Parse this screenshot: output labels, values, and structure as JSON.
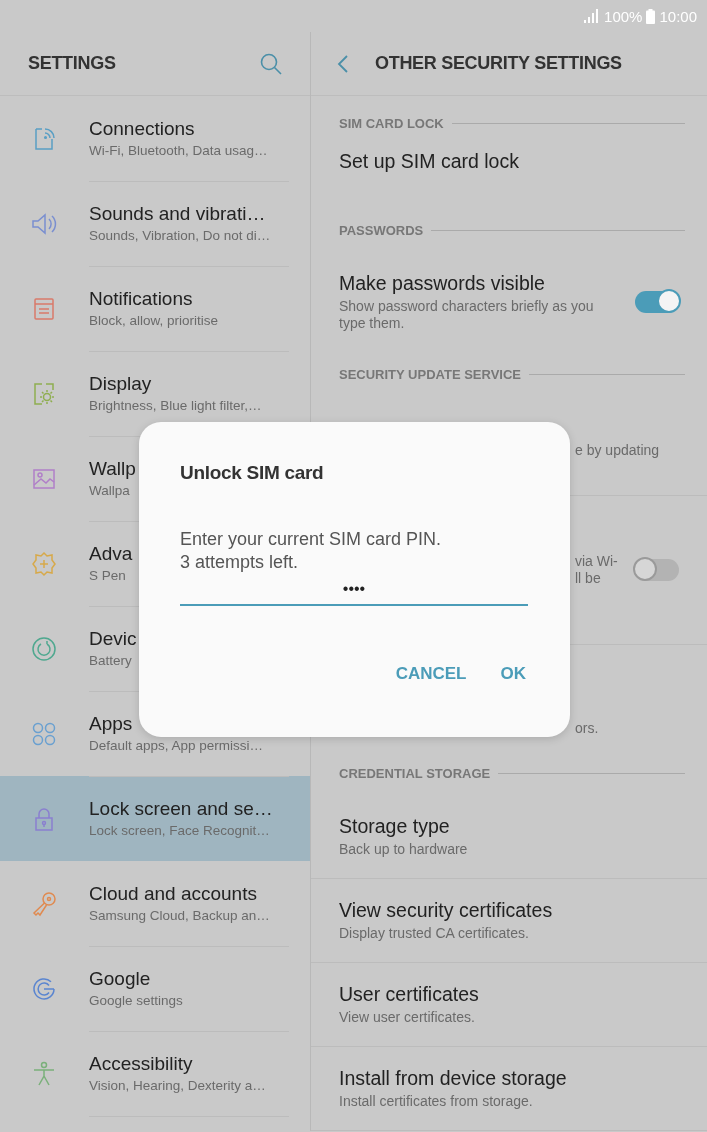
{
  "status_bar": {
    "battery": "100%",
    "time": "10:00"
  },
  "left": {
    "title": "SETTINGS",
    "items": [
      {
        "title": "Connections",
        "subtitle": "Wi-Fi, Bluetooth, Data usag…",
        "selected": false
      },
      {
        "title": "Sounds and vibrati…",
        "subtitle": "Sounds, Vibration, Do not di…",
        "selected": false
      },
      {
        "title": "Notifications",
        "subtitle": "Block, allow, prioritise",
        "selected": false
      },
      {
        "title": "Display",
        "subtitle": "Brightness, Blue light filter,…",
        "selected": false
      },
      {
        "title": "Wallp",
        "subtitle": "Wallpa",
        "selected": false
      },
      {
        "title": "Adva",
        "subtitle": "S Pen",
        "selected": false
      },
      {
        "title": "Devic",
        "subtitle": "Battery",
        "selected": false
      },
      {
        "title": "Apps",
        "subtitle": "Default apps, App permissi…",
        "selected": false
      },
      {
        "title": "Lock screen and se…",
        "subtitle": "Lock screen, Face Recognit…",
        "selected": true
      },
      {
        "title": "Cloud and accounts",
        "subtitle": "Samsung Cloud, Backup an…",
        "selected": false
      },
      {
        "title": "Google",
        "subtitle": "Google settings",
        "selected": false
      },
      {
        "title": "Accessibility",
        "subtitle": "Vision, Hearing, Dexterity a…",
        "selected": false
      }
    ]
  },
  "right": {
    "title": "OTHER SECURITY SETTINGS",
    "rows": [
      {
        "kind": "header",
        "text": "SIM CARD LOCK"
      },
      {
        "kind": "item",
        "title": "Set up SIM card lock"
      },
      {
        "kind": "header",
        "text": "PASSWORDS"
      },
      {
        "kind": "item",
        "title": "Make passwords visible",
        "subtitle": "Show password characters briefly as you type them.",
        "on": true
      },
      {
        "kind": "header",
        "text": "SECURITY UPDATE SERVICE"
      },
      {
        "kind": "partial",
        "lines": [
          "e by updating"
        ]
      },
      {
        "kind": "partial",
        "lines": [
          "via Wi-",
          "ll be"
        ],
        "on": false
      },
      {
        "kind": "partial",
        "lines": [
          "ors."
        ]
      },
      {
        "kind": "header",
        "text": "CREDENTIAL STORAGE"
      },
      {
        "kind": "item",
        "title": "Storage type",
        "subtitle": "Back up to hardware"
      },
      {
        "kind": "item",
        "title": "View security certificates",
        "subtitle": "Display trusted CA certificates."
      },
      {
        "kind": "item",
        "title": "User certificates",
        "subtitle": "View user certificates."
      },
      {
        "kind": "item",
        "title": "Install from device storage",
        "subtitle": "Install certificates from storage."
      }
    ]
  },
  "dialog": {
    "title": "Unlock SIM card",
    "message": [
      "Enter your current SIM card PIN.",
      "3 attempts left."
    ],
    "pin": "••••",
    "buttons": [
      "CANCEL",
      "OK"
    ]
  }
}
